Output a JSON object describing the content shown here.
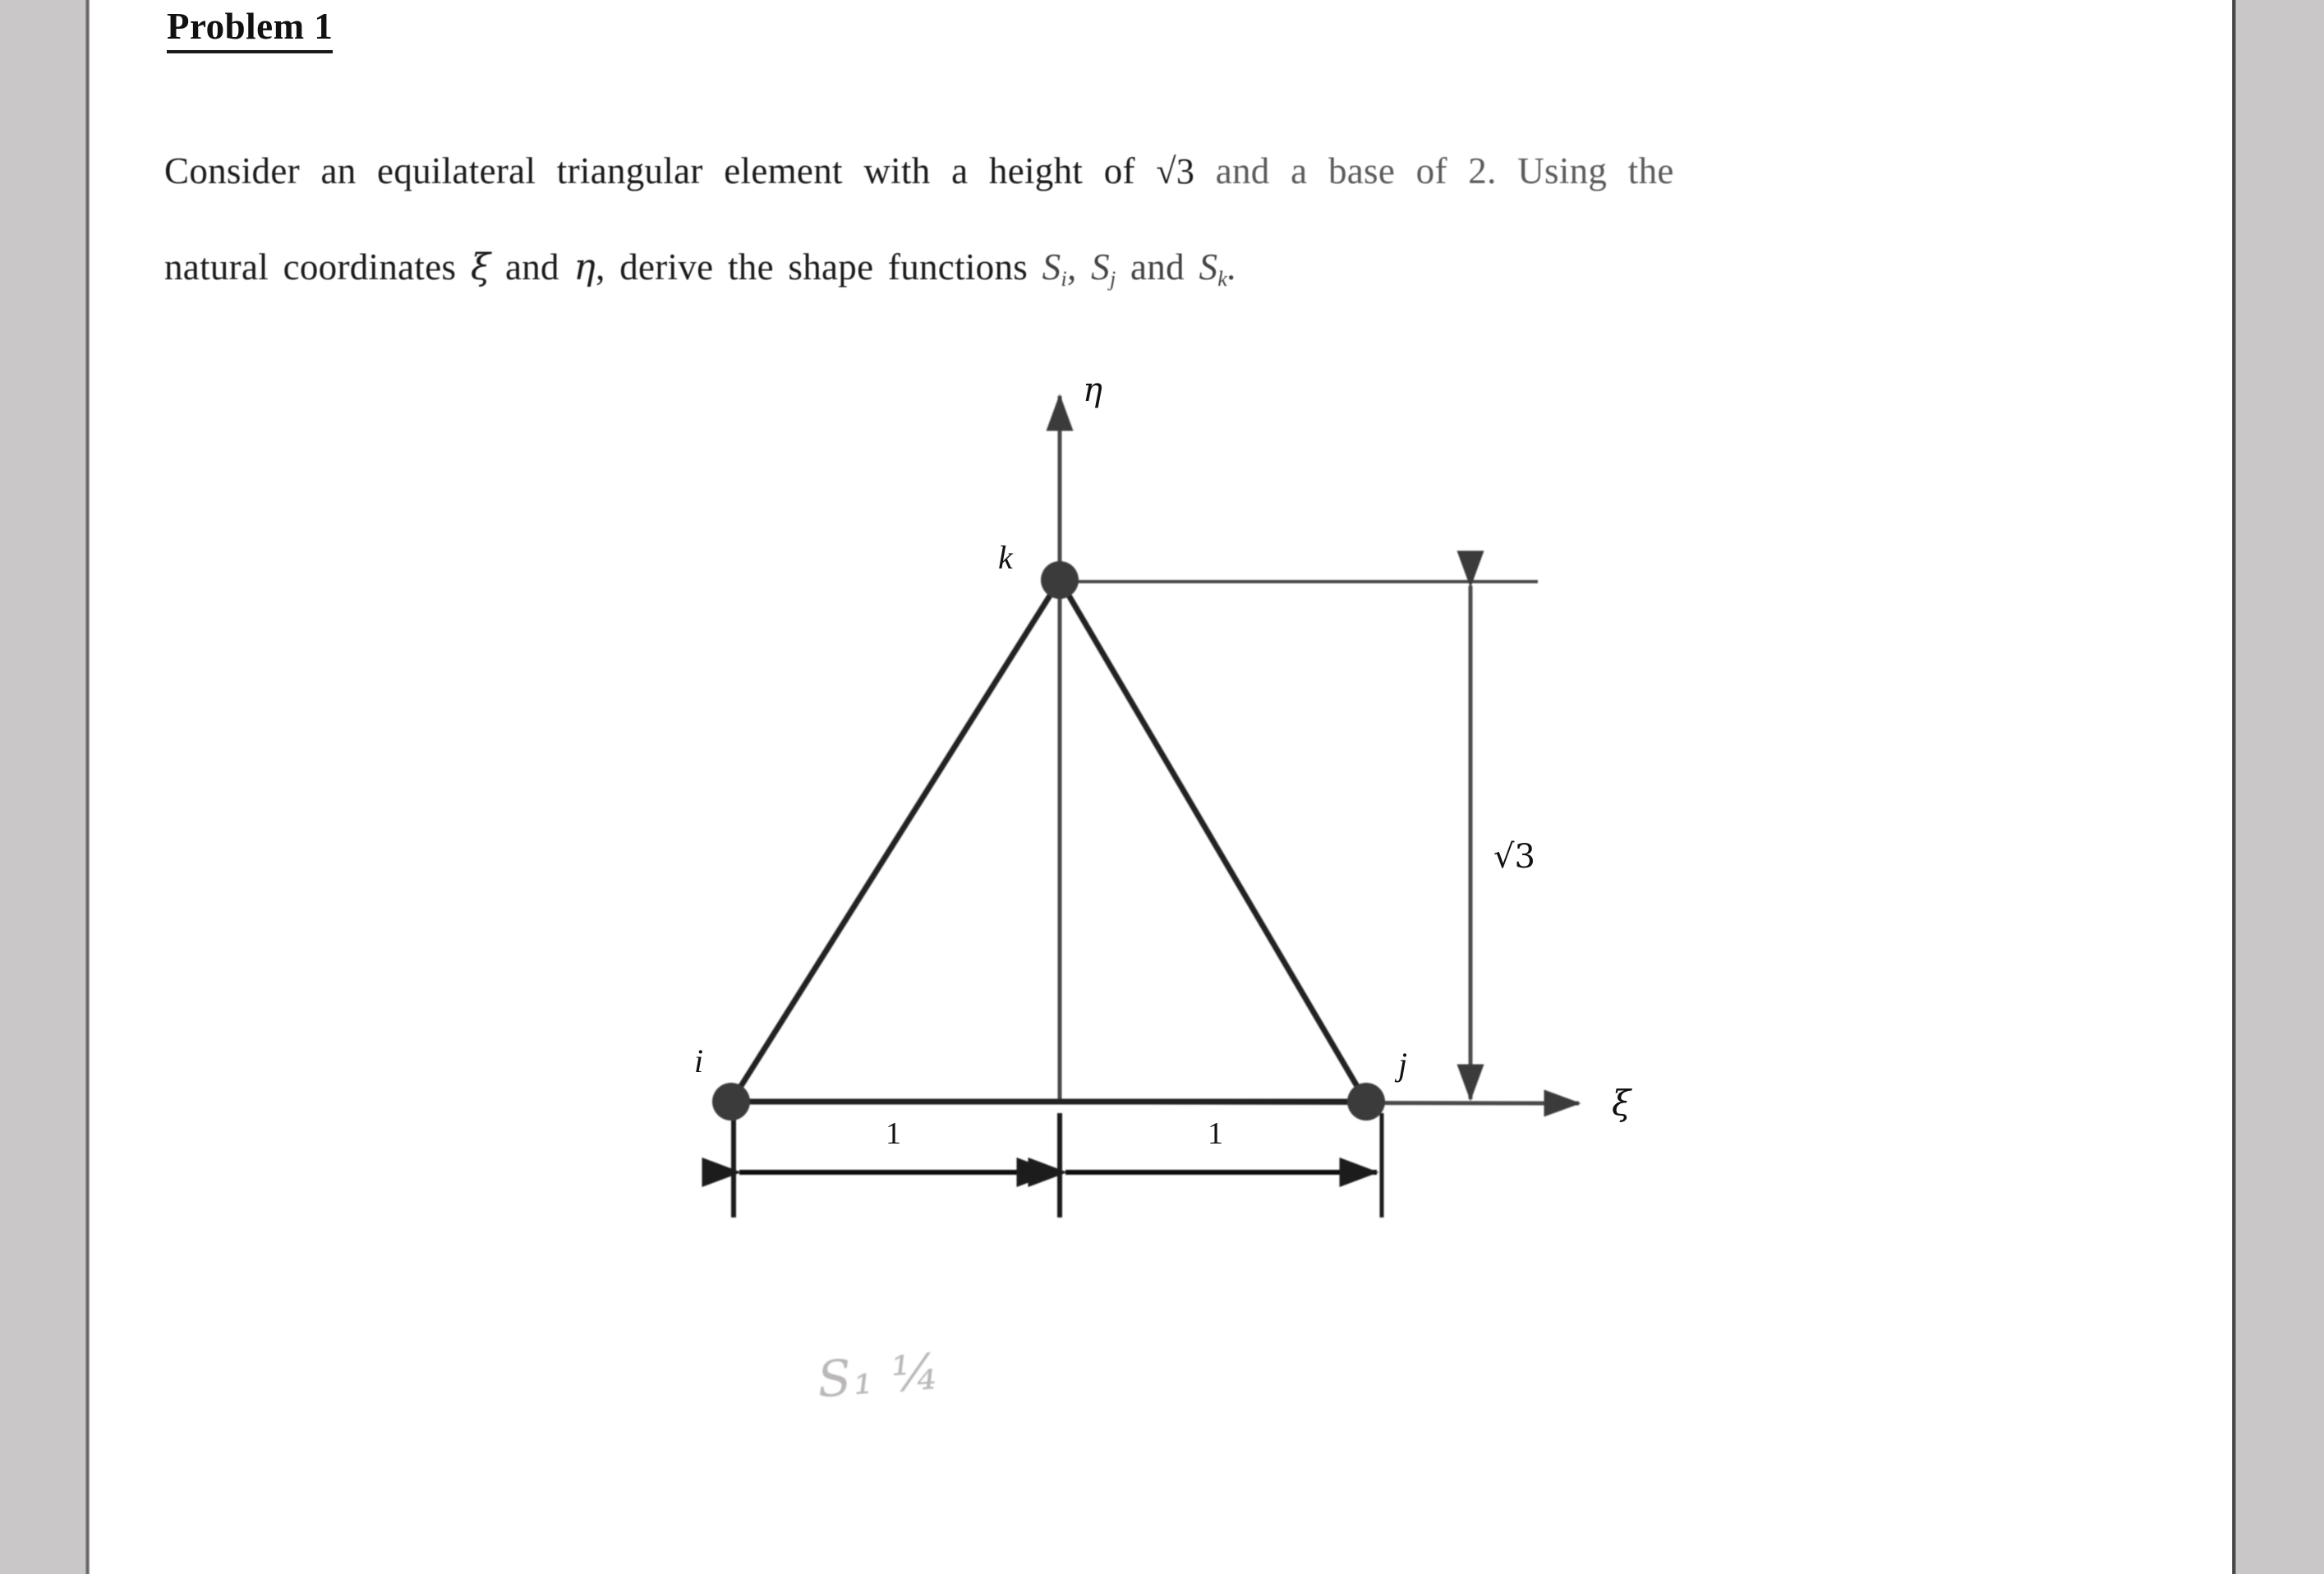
{
  "document": {
    "title": "Problem 1",
    "paragraph": {
      "line1_a": "Consider an equilateral triangular element with a height of",
      "line1_sqrt": "√3",
      "line1_b": "and a base of 2. Using the",
      "line2_a": "natural coordinates",
      "line2_xi": "ξ",
      "line2_b": "and",
      "line2_eta": "η",
      "line2_c": ", derive the shape functions",
      "line2_si": "S",
      "line2_si_sub": "i",
      "line2_sj": "S",
      "line2_sj_sub": "j",
      "line2_and": "and",
      "line2_sk": "S",
      "line2_sk_sub": "k",
      "line2_period": "."
    }
  },
  "figure": {
    "axis_vertical_label": "η",
    "axis_horizontal_label": "ξ",
    "node_k_label": "k",
    "node_i_label": "i",
    "node_j_label": "j",
    "height_label": "√3",
    "dim_left_label": "1",
    "dim_right_label": "1",
    "geometry": {
      "apex_k": [
        1290,
        706
      ],
      "node_i": [
        890,
        1341
      ],
      "node_j": [
        1663,
        1341
      ],
      "base_length": 2,
      "height": "√3",
      "half_base_left": 1,
      "half_base_right": 1
    },
    "colors": {
      "ink": "#1a1a1a",
      "node_fill": "#3a3a3a",
      "paper": "#ffffff",
      "scan_margin": "#c9c7c8"
    }
  },
  "annotations": {
    "handwritten_note": "S₁ ¼"
  }
}
